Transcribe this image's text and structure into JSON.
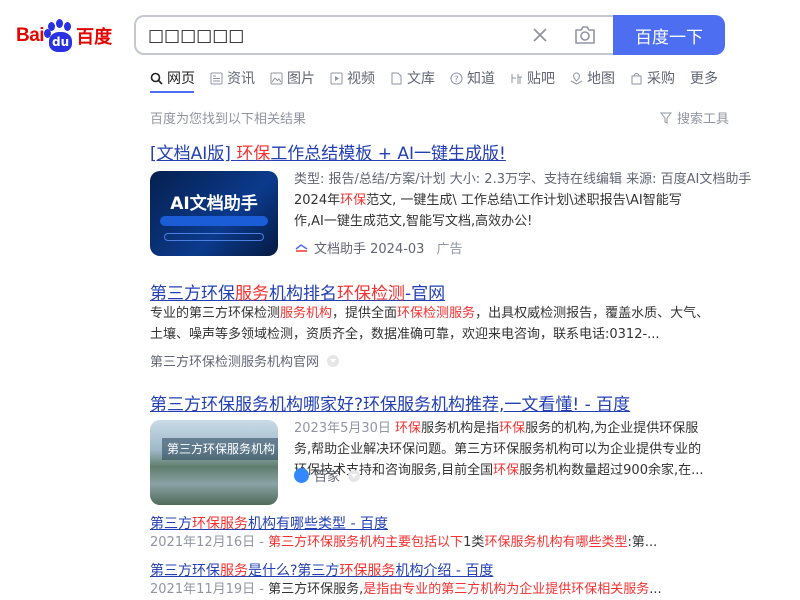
{
  "logo": {
    "bai": "Bai",
    "du": "du",
    "cn": "百度"
  },
  "search": {
    "value": "□□□□□□",
    "button": "百度一下"
  },
  "tabs": [
    {
      "label": "网页",
      "icon": "search-icon"
    },
    {
      "label": "资讯",
      "icon": "news-icon"
    },
    {
      "label": "图片",
      "icon": "image-icon"
    },
    {
      "label": "视频",
      "icon": "video-icon"
    },
    {
      "label": "文库",
      "icon": "doc-icon"
    },
    {
      "label": "知道",
      "icon": "question-icon"
    },
    {
      "label": "贴吧",
      "icon": "tieba-icon"
    },
    {
      "label": "地图",
      "icon": "map-icon"
    },
    {
      "label": "采购",
      "icon": "shop-icon"
    },
    {
      "label": "更多",
      "icon": ""
    }
  ],
  "hint": "百度为您找到以下相关结果",
  "tools": "搜索工具",
  "results": [
    {
      "title_a": "[文档AI版] ",
      "title_em": "环保",
      "title_b": "工作总结模板 + AI一键生成版!",
      "meta": "类型: 报告/总结/方案/计划    大小: 2.3万字、支持在线编辑    来源: 百度AI文档助手",
      "abstract_a": "2024年",
      "abstract_em": "环保",
      "abstract_b": "范文, 一键生成\\ 工作总结\\工作计划\\述职报告\\AI智能写作,AI一键生成范文,智能写文档,高效办公!",
      "thumb_title": "AI文档助手",
      "source": "文档助手 2024-03",
      "ad": "广告"
    },
    {
      "title_a": "第三方环保",
      "title_em": "服务",
      "title_b": "机构排名",
      "title_em2": "环保检测",
      "title_c": "-官网",
      "abstract_a": "专业的第三方环保检测",
      "abstract_em": "服务机构",
      "abstract_b": "，提供全面",
      "abstract_em2": "环保检测服务",
      "abstract_c": "，出具权威检测报告，覆盖水质、大气、土壤、噪声等多领域检测，资质齐全，数据准确可靠，欢迎来电咨询，联系电话:0312-...",
      "source": "第三方环保检测服务机构官网",
      "ad": ""
    },
    {
      "title": "第三方环保服务机构哪家好?环保服务机构推荐,一文看懂! - 百度",
      "date": "2023年5月30日",
      "abstract_em": "环保",
      "abstract_a": "服务机构是指",
      "abstract_em2": "环保",
      "abstract_b": "服务的机构,为企业提供环保服务,帮助企业解决环保问题。第三方环保服务机构可以为企业提供专业的环保技术支持和咨询服务,目前全国",
      "abstract_em3": "环保",
      "abstract_c": "服务机构数量超过900余家,在...",
      "thumb_caption": "第三方环保服务机构",
      "source": "百家"
    }
  ],
  "sub_results": [
    {
      "title_a": "第三方",
      "title_em": "环保服务",
      "title_b": "机构有哪些类型 - 百度",
      "date": "2021年12月16日 -",
      "abstract_em": "第三方环保服务机构主要包括以下",
      "abstract_a": "1类",
      "abstract_em2": "环保服务机构有哪些类型",
      "abstract_b": ":第..."
    },
    {
      "title_a": "第三方环保",
      "title_em": "服务",
      "title_b": "是什么?第三方",
      "title_em2": "环保服务",
      "title_c": "机构介绍 - 百度",
      "date": "2021年11月19日 -",
      "abstract_a": "第三方环保服务,",
      "abstract_em": "是指由专业的第三方机构为企业提供环保相关服务",
      "abstract_b": "..."
    }
  ]
}
